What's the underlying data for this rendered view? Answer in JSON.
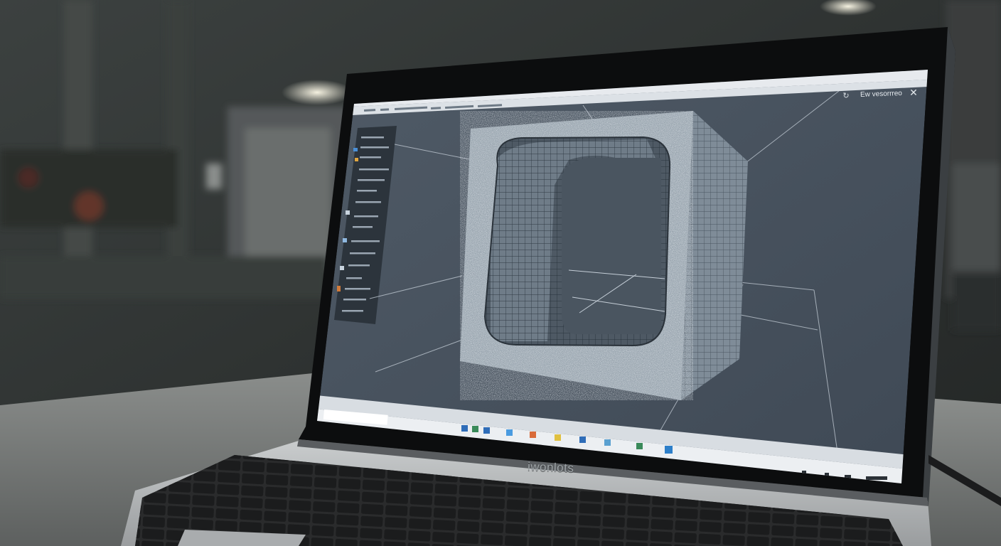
{
  "window": {
    "title": "Ew vesorrreo",
    "close_glyph": "✕",
    "refresh_glyph": "↻"
  },
  "laptop": {
    "brand_text": "iwonlots"
  },
  "colors": {
    "viewport_bg": "#4a5561",
    "sidebar_bg": "#2c343c",
    "mesh_base": "#8c99a4",
    "taskbar_bg": "#e9ecef",
    "keyboard_body": "#b8bbbd",
    "desk": "#7d807e"
  },
  "icons": {
    "sidebar": [
      "folder-icon",
      "cube-icon",
      "layers-icon",
      "gear-icon",
      "tools-icon"
    ],
    "taskbar": [
      "start-icon",
      "search-icon",
      "explorer-icon",
      "browser-icon",
      "mail-icon",
      "store-icon",
      "cad-app-icon"
    ],
    "tray": [
      "network-icon",
      "volume-icon",
      "battery-icon",
      "clock-icon"
    ]
  }
}
